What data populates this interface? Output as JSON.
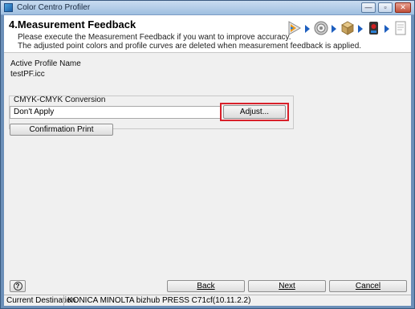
{
  "window": {
    "title": "Color Centro Profiler",
    "minimize_glyph": "—",
    "restore_glyph": "▫",
    "close_glyph": "✕"
  },
  "header": {
    "step_title": "4.Measurement Feedback",
    "description_line1": "Please execute the Measurement Feedback if you want to improve accuracy.",
    "description_line2": "The adjusted point colors and profile curves are deleted when measurement feedback is applied.",
    "step_icons": [
      "spectrum-icon",
      "gear-icon",
      "printer-box-icon",
      "measure-device-icon",
      "document-icon"
    ]
  },
  "form": {
    "active_profile_label": "Active Profile Name",
    "active_profile_value": "testPF.icc",
    "conversion_group_label": "CMYK-CMYK Conversion",
    "conversion_value": "Don't Apply",
    "adjust_button": "Adjust...",
    "confirmation_print_button": "Confirmation Print"
  },
  "footer": {
    "help_glyph": "?",
    "back_button": "Back",
    "next_button": "Next",
    "cancel_button": "Cancel"
  },
  "status": {
    "destination_label": "Current Destination",
    "destination_value": "KONICA MINOLTA bizhub PRESS C71cf(10.11.2.2)"
  },
  "colors": {
    "highlight": "#d8202a",
    "arrow": "#1e5fbf"
  }
}
